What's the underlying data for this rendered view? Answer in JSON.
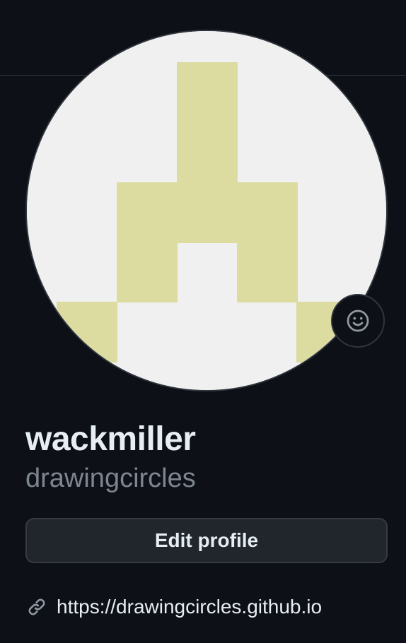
{
  "profile": {
    "display_name": "wackmiller",
    "username": "drawingcircles",
    "edit_profile_label": "Edit profile",
    "website": "https://drawingcircles.github.io"
  },
  "avatar": {
    "type": "identicon",
    "background_color": "#f0f0f0",
    "fill_color": "#dcdca1"
  },
  "icons": {
    "status": "smiley-icon",
    "website": "link-icon"
  },
  "colors": {
    "page_background": "#0d1117",
    "text_primary": "#e6edf3",
    "text_muted": "#7d8590",
    "border": "#30363d",
    "button_background": "#21262d"
  }
}
